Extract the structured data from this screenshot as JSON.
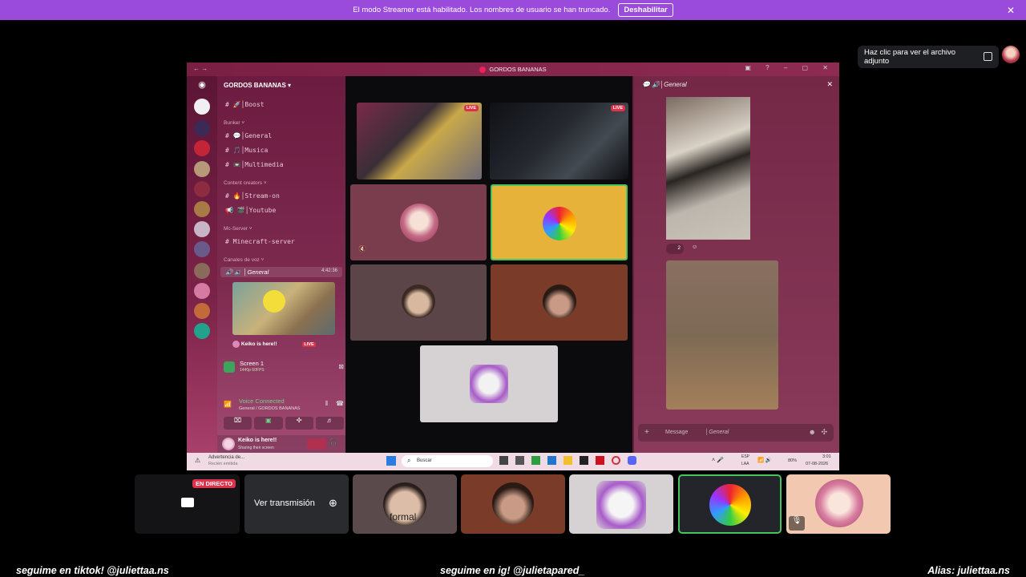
{
  "banner": {
    "text": "El modo Streamer está habilitado. Los nombres de usuario se han truncado.",
    "button": "Deshabilitar",
    "close": "✕"
  },
  "tooltip": {
    "text": "Haz clic para ver el archivo adjunto"
  },
  "window": {
    "title": "GORDOS BANANAS",
    "server_name": "GORDOS BANANAS",
    "channels": {
      "boost": "Boost",
      "cat_bunker": "Bunker",
      "general": "General",
      "musica": "Musica",
      "multimedia": "Multimedia",
      "cat_content": "Content creators",
      "stream_on": "Stream-on",
      "youtube": "Youtube",
      "cat_mc": "Mc-Server",
      "minecraft": "Minecraft-server",
      "cat_voice": "Canales de voz",
      "voice_general": "General",
      "voice_time": "4:42:36",
      "voice_user": "Keiko is here!!",
      "voice_live": "LIVE"
    },
    "screen_panel": {
      "title": "Screen 1",
      "sub": "1440p 60FPS"
    },
    "voice": {
      "status": "Voice Connected",
      "sub": "General / GORDOS BANANAS"
    },
    "user": {
      "name": "Keiko is here!!",
      "status": "Sharing their screen"
    },
    "side": {
      "channel": "General",
      "reaction_count": "2",
      "message_placeholder": "Message",
      "message_channel": "General"
    },
    "stage": {
      "live_label": "LIVE"
    },
    "taskbar": {
      "notif_title": "Advertencia de...",
      "notif_sub": "Recién emitida",
      "search": "Buscar",
      "lang1": "ESP",
      "lang2": "LAA",
      "battery": "80%",
      "time": "3:01",
      "date": "07-08-2026"
    }
  },
  "bottom": {
    "live_badge": "EN DIRECTO",
    "watch": "Ver transmisión",
    "face_text": "formal"
  },
  "captions": {
    "left": "seguime en tiktok!  @juliettaa.ns",
    "center": "seguime en ig!   @julietapared_",
    "right": "Alias: juliettaa.ns"
  }
}
